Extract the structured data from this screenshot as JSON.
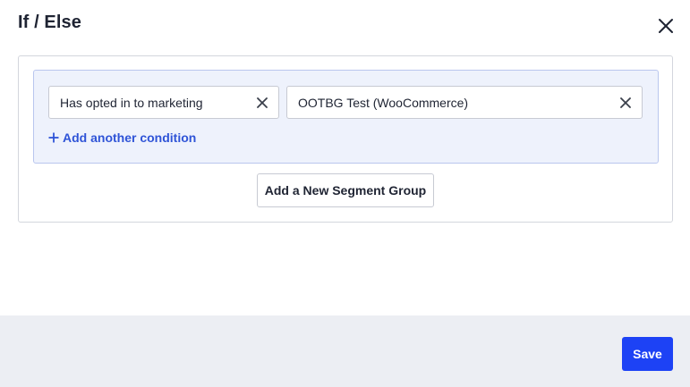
{
  "modal": {
    "title": "If / Else"
  },
  "segment_group": {
    "conditions": [
      {
        "label": "Has opted in to marketing"
      },
      {
        "label": "OOTBG Test (WooCommerce)"
      }
    ],
    "add_condition_label": "Add another condition"
  },
  "add_segment_group_label": "Add a New Segment Group",
  "footer": {
    "save_label": "Save"
  },
  "icons": {
    "close": "close-icon",
    "remove_condition": "close-icon",
    "add": "plus-icon"
  },
  "colors": {
    "accent": "#1d42f5",
    "link": "#2f54d7",
    "segment_bg": "#eef2fc",
    "segment_border": "#b9c6ee",
    "footer_bg": "#eceef3"
  }
}
